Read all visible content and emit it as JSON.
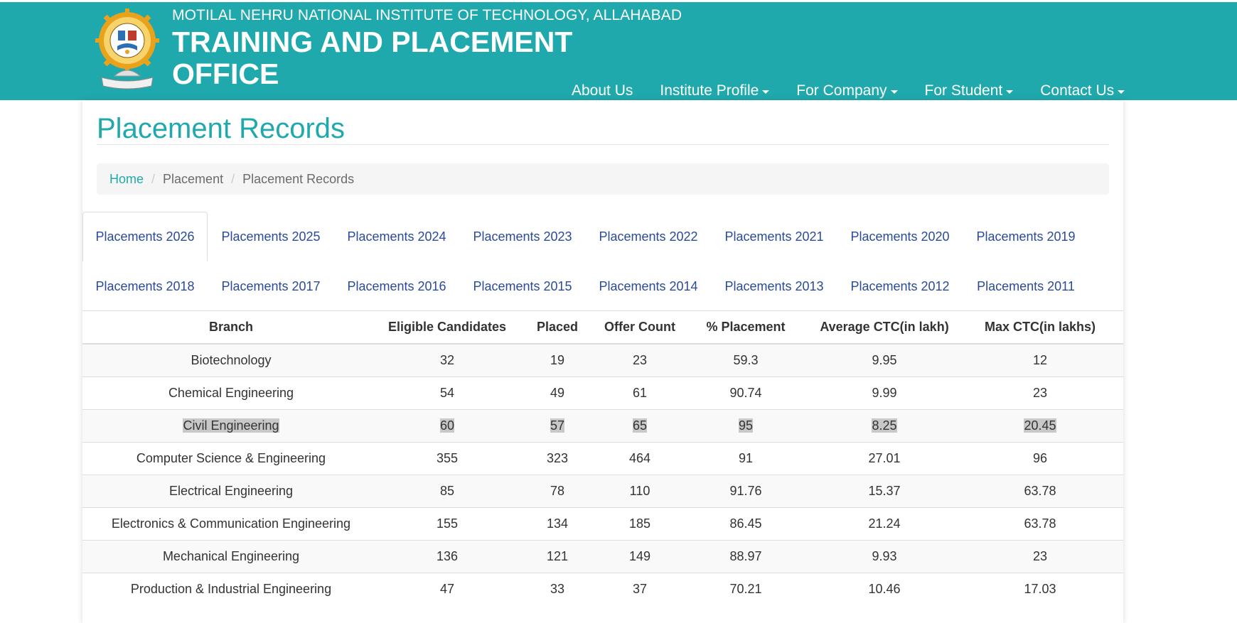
{
  "header": {
    "institute": "MOTILAL NEHRU NATIONAL INSTITUTE OF TECHNOLOGY, ALLAHABAD",
    "office": "TRAINING AND PLACEMENT OFFICE",
    "logo_icon": "institute-seal-logo",
    "nav": [
      {
        "label": "About Us",
        "dropdown": false
      },
      {
        "label": "Institute Profile",
        "dropdown": true
      },
      {
        "label": "For Company",
        "dropdown": true
      },
      {
        "label": "For Student",
        "dropdown": true
      },
      {
        "label": "Contact Us",
        "dropdown": true
      }
    ]
  },
  "page": {
    "title": "Placement Records",
    "breadcrumb": [
      "Home",
      "Placement",
      "Placement Records"
    ]
  },
  "tabs": [
    "Placements 2026",
    "Placements 2025",
    "Placements 2024",
    "Placements 2023",
    "Placements 2022",
    "Placements 2021",
    "Placements 2020",
    "Placements 2019",
    "Placements 2018",
    "Placements 2017",
    "Placements 2016",
    "Placements 2015",
    "Placements 2014",
    "Placements 2013",
    "Placements 2012",
    "Placements 2011"
  ],
  "active_tab": "Placements 2026",
  "table": {
    "headers": [
      "Branch",
      "Eligible Candidates",
      "Placed",
      "Offer Count",
      "% Placement",
      "Average CTC(in lakh)",
      "Max CTC(in lakhs)"
    ],
    "rows": [
      [
        "Biotechnology",
        "32",
        "19",
        "23",
        "59.3",
        "9.95",
        "12"
      ],
      [
        "Chemical Engineering",
        "54",
        "49",
        "61",
        "90.74",
        "9.99",
        "23"
      ],
      [
        "Civil Engineering",
        "60",
        "57",
        "65",
        "95",
        "8.25",
        "20.45"
      ],
      [
        "Computer Science & Engineering",
        "355",
        "323",
        "464",
        "91",
        "27.01",
        "96"
      ],
      [
        "Electrical Engineering",
        "85",
        "78",
        "110",
        "91.76",
        "15.37",
        "63.78"
      ],
      [
        "Electronics & Communication Engineering",
        "155",
        "134",
        "185",
        "86.45",
        "21.24",
        "63.78"
      ],
      [
        "Mechanical Engineering",
        "136",
        "121",
        "149",
        "88.97",
        "9.93",
        "23"
      ],
      [
        "Production & Industrial Engineering",
        "47",
        "33",
        "37",
        "70.21",
        "10.46",
        "17.03"
      ]
    ],
    "highlighted_row": 2
  },
  "colors": {
    "header_bg": "#20a9ad",
    "title": "#20a9ad",
    "tab_link": "#2a4a9a",
    "highlight": "#c8c8c8"
  }
}
